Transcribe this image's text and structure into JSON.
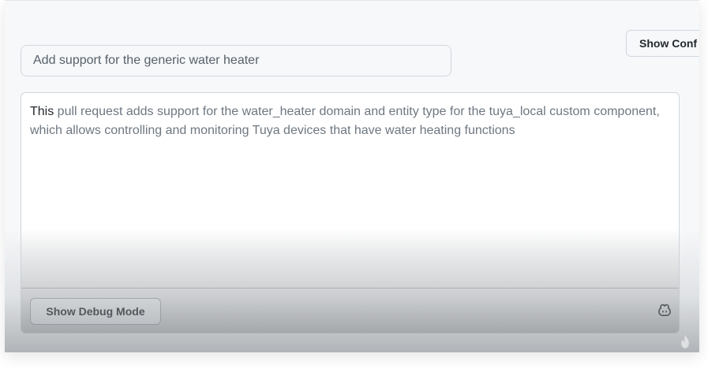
{
  "title_input": {
    "value": "Add support for the generic water heater"
  },
  "toolbar": {
    "show_config_label": "Show Conf"
  },
  "description": {
    "lead_word": "This",
    "rest": " pull request adds support for the water_heater domain and entity type for the tuya_local custom component, which allows controlling and monitoring Tuya devices that have water heating functions"
  },
  "footer": {
    "debug_label": "Show Debug Mode"
  },
  "icons": {
    "assistant": "copilot-icon",
    "watermark": "flame-icon"
  },
  "colors": {
    "panel_bg": "#f6f8fa",
    "border": "#d0d7de",
    "text_primary": "#24292f",
    "text_muted": "#6e7781"
  }
}
